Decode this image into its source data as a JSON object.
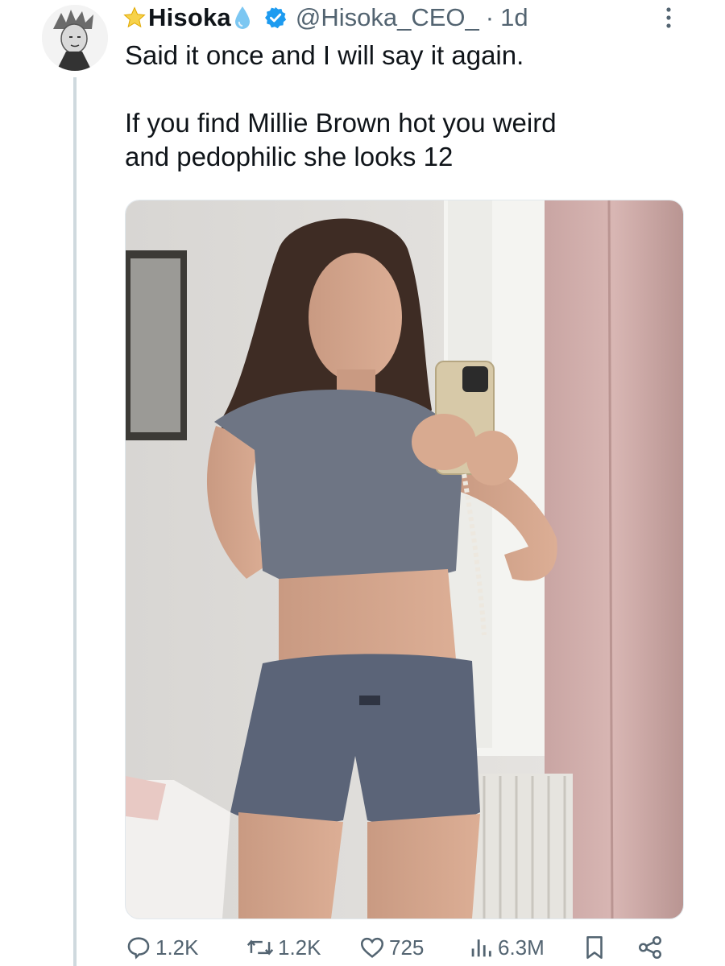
{
  "tweet": {
    "display_name": "Hisoka",
    "handle": "@Hisoka_CEO_",
    "separator": "·",
    "time": "1d",
    "text": "Said it once and I will say it again.\n\nIf you find Millie Brown hot you weird\nand pedophilic she looks 12"
  },
  "actions": {
    "replies": "1.2K",
    "reposts": "1.2K",
    "likes": "725",
    "views": "6.3M"
  },
  "colors": {
    "text": "#0f1419",
    "muted": "#536471",
    "verified": "#1d9bf0",
    "thread_line": "#cfd9de"
  },
  "icons": {
    "badge": "star-icon",
    "emoji": "droplet-icon",
    "verified": "verified-badge-icon",
    "reply": "reply-icon",
    "repost": "repost-icon",
    "like": "heart-icon",
    "views": "views-icon",
    "bookmark": "bookmark-icon",
    "share": "share-icon"
  }
}
